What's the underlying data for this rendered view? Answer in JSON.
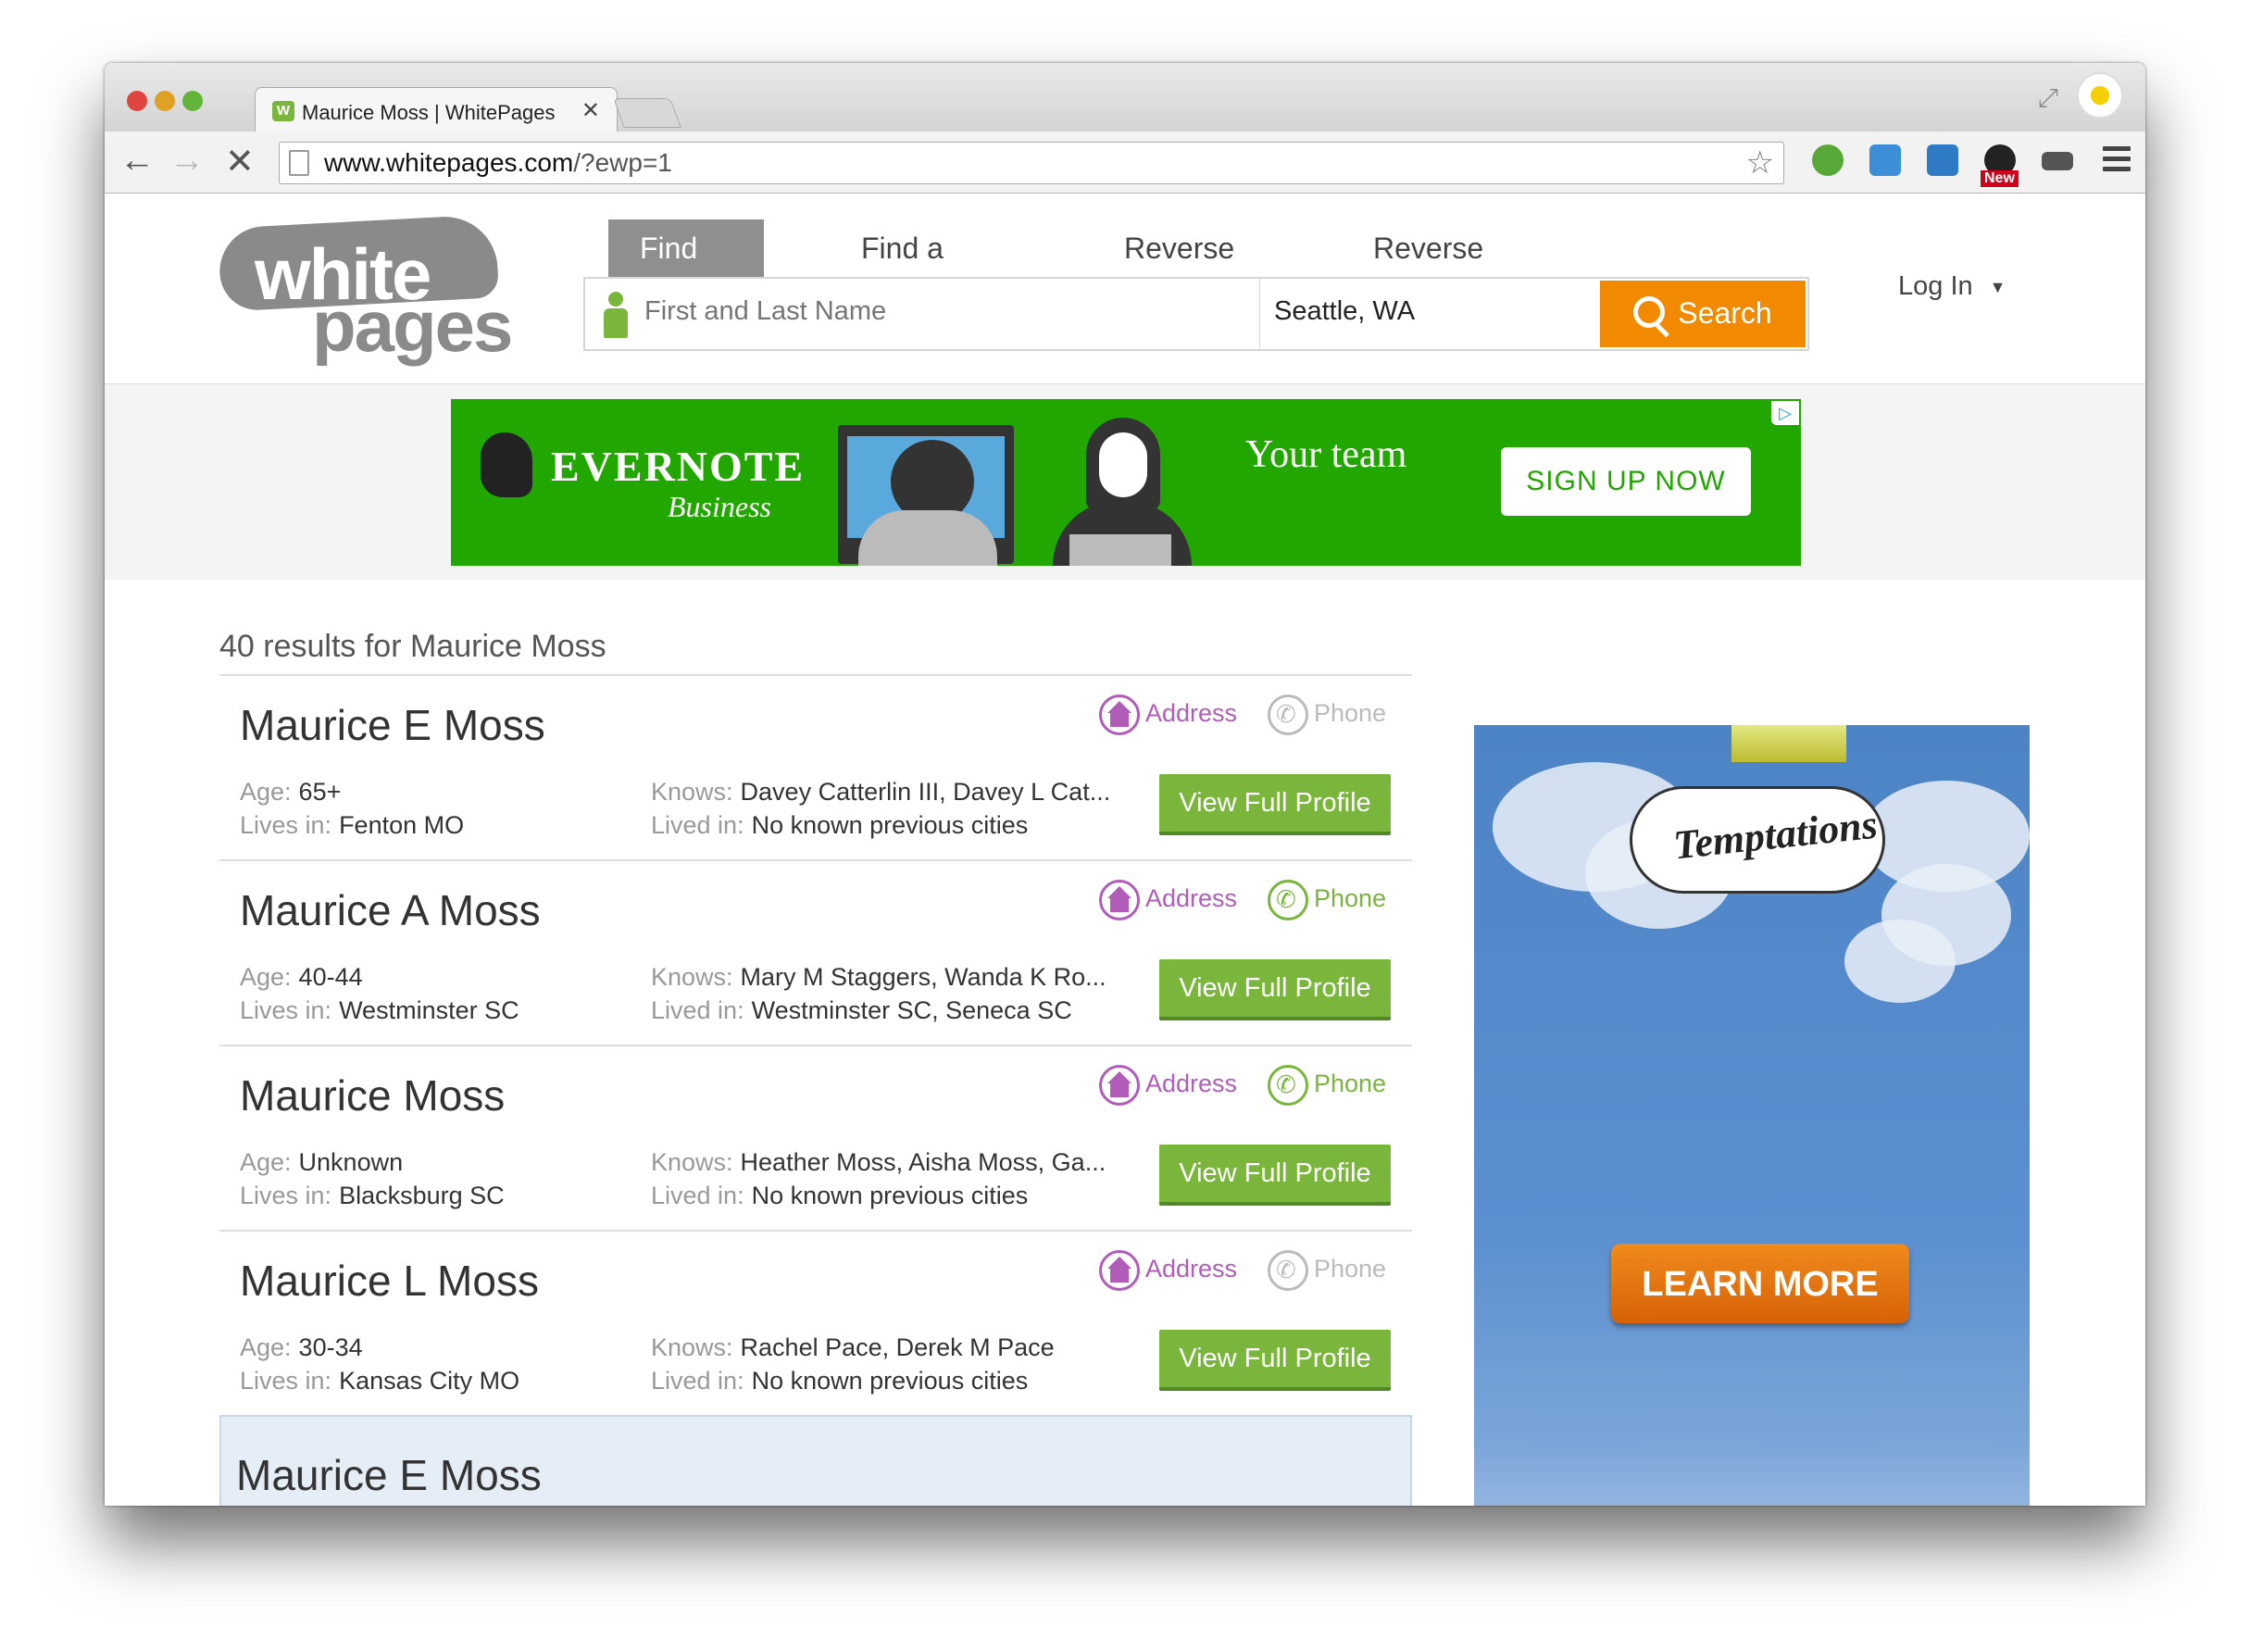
{
  "browser": {
    "tab_title": "Maurice Moss | WhitePages",
    "url_domain": "www.whitepages.com",
    "url_path": "/?ewp=1",
    "extensions": [
      "sync-icon",
      "puzzle-icon",
      "photo-icon",
      "dashboard-icon",
      "mask-icon"
    ],
    "new_badge": "New"
  },
  "header": {
    "logo_line1": "white",
    "logo_line2": "pages",
    "nav_tabs": [
      "Find People",
      "Find a Business",
      "Reverse Phone",
      "Reverse Address"
    ],
    "name_placeholder": "First and Last Name",
    "location_value": "Seattle, WA",
    "search_label": "Search",
    "login_label": "Log In"
  },
  "banner_ad": {
    "brand": "EVERNOTE",
    "sub": "Business",
    "tagline": "Your team",
    "cta": "SIGN UP NOW",
    "colors": {
      "background": "#22a600"
    }
  },
  "results": {
    "count_text": "40 results for Maurice Moss",
    "labels": {
      "age": "Age:",
      "lives_in": "Lives in:",
      "knows": "Knows:",
      "lived_in": "Lived in:",
      "address": "Address",
      "phone": "Phone",
      "view_profile": "View Full Profile"
    },
    "items": [
      {
        "name": "Maurice E Moss",
        "age": "65+",
        "lives_in": "Fenton MO",
        "knows": "Davey Catterlin III, Davey L Cat...",
        "lived_in": "No known previous cities",
        "phone_available": false
      },
      {
        "name": "Maurice A Moss",
        "age": "40-44",
        "lives_in": "Westminster SC",
        "knows": "Mary M Staggers, Wanda K Ro...",
        "lived_in": "Westminster SC, Seneca SC",
        "phone_available": true
      },
      {
        "name": "Maurice Moss",
        "age": "Unknown",
        "lives_in": "Blacksburg SC",
        "knows": "Heather Moss, Aisha Moss, Ga...",
        "lived_in": "No known previous cities",
        "phone_available": true
      },
      {
        "name": "Maurice L Moss",
        "age": "30-34",
        "lives_in": "Kansas City MO",
        "knows": "Rachel Pace, Derek M Pace",
        "lived_in": "No known previous cities",
        "phone_available": false
      }
    ],
    "highlight_name": "Maurice E Moss"
  },
  "side_ad": {
    "brand": "Temptations",
    "cta": "LEARN MORE"
  },
  "colors": {
    "accent_green": "#7ab53c",
    "search_orange": "#f28a00",
    "address_purple": "#b05cb8"
  }
}
